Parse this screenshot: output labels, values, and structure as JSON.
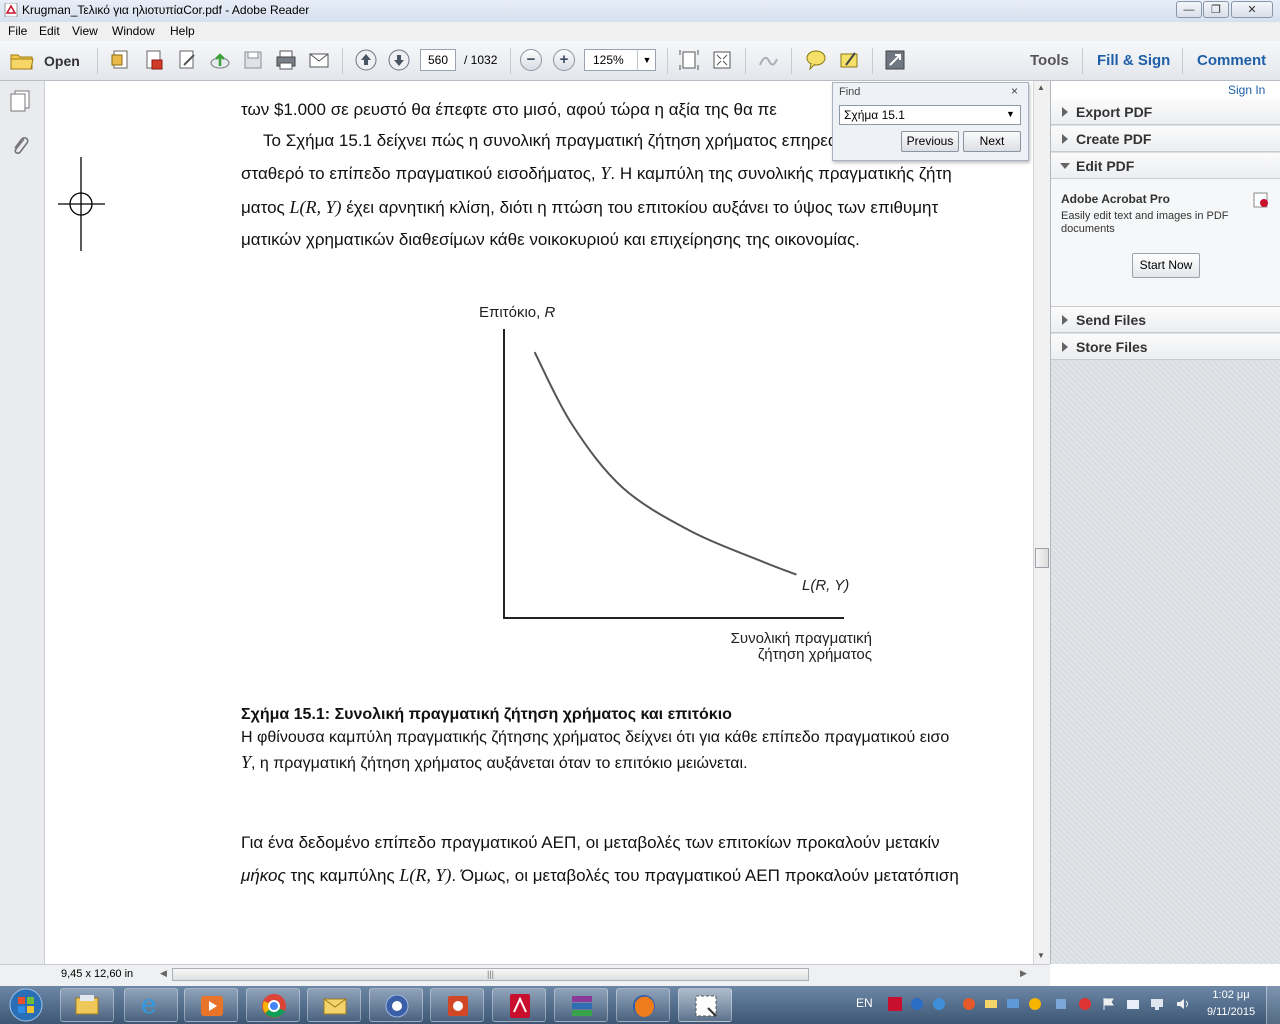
{
  "window": {
    "title": "Krugman_Τελικό για ηλιοτυπίαCor.pdf - Adobe Reader",
    "min_label": "—",
    "max_label": "❐",
    "close_label": "✕"
  },
  "menu": [
    "File",
    "Edit",
    "View",
    "Window",
    "Help"
  ],
  "toolbar": {
    "open_label": "Open",
    "page_current": "560",
    "page_total": "/ 1032",
    "zoom": "125%",
    "tabs": [
      "Tools",
      "Fill & Sign",
      "Comment"
    ],
    "signin": "Sign In"
  },
  "find": {
    "title": "Find",
    "query": "Σχήμα 15.1",
    "previous": "Previous",
    "next": "Next"
  },
  "document": {
    "line1": "των $1.000 σε ρευστό θα έπεφτε στο μισό, αφού τώρα η αξία της θα πε",
    "para2_l1": "Το Σχήμα 15.1 δείχνει πώς η συνολική πραγματική ζήτηση χρήματος επηρεάζ",
    "para2_l2a": "σταθερό το επίπεδο πραγματικού εισοδήματος, ",
    "para2_l2_var": "Y",
    "para2_l2b": ". Η καμπύλη της συνολικής πραγματικής ζήτη",
    "para2_l3a": "ματος ",
    "para2_l3_var": "L(R, Y)",
    "para2_l3b": " έχει αρνητική κλίση, διότι η πτώση του επιτοκίου αυξάνει το ύψος των επιθυμητ",
    "para2_l4": "ματικών χρηματικών διαθεσίμων κάθε νοικοκυριού και επιχείρησης της οικονομίας.",
    "caption_title": "Σχήμα 15.1: Συνολική πραγματική ζήτηση χρήματος και επιτόκιο",
    "caption_l1": "Η φθίνουσα καμπύλη πραγματικής ζήτησης χρήματος δείχνει ότι για κάθε επίπεδο πραγματικού εισο",
    "caption_l2_var": "Y",
    "caption_l2": ", η πραγματική ζήτηση χρήματος αυξάνεται όταν το επιτόκιο μειώνεται.",
    "para3_l1": "Για ένα δεδομένο επίπεδο πραγματικού ΑΕΠ, οι μεταβολές των επιτοκίων προκαλούν μετακίν",
    "para3_l2_em": "μήκος",
    "para3_l2a": " της καμπύλης ",
    "para3_l2_var": "L(R, Y)",
    "para3_l2b": ". Όμως, οι μεταβολές του πραγματικού ΑΕΠ προκαλούν μετατόπιση"
  },
  "chart_data": {
    "type": "line",
    "ylabel_text": "Επιτόκιο, ",
    "ylabel_var": "R",
    "xlabel_l1": "Συνολική πραγματική",
    "xlabel_l2": "ζήτηση χρήματος",
    "series": [
      {
        "name": "L(R, Y)",
        "points_note": "",
        "x": [
          0.09,
          0.2,
          0.35,
          0.55,
          0.75,
          0.86
        ],
        "y": [
          0.92,
          0.67,
          0.45,
          0.3,
          0.2,
          0.15
        ]
      }
    ],
    "xlim": [
      0,
      1
    ],
    "ylim": [
      0,
      1
    ]
  },
  "rightpanel": {
    "sections_top": [
      "Export PDF",
      "Create PDF",
      "Edit PDF"
    ],
    "promo_title": "Adobe Acrobat Pro",
    "promo_desc_l1": "Easily edit text and images in PDF",
    "promo_desc_l2": "documents",
    "start_now": "Start Now",
    "sections_bottom": [
      "Send Files",
      "Store Files"
    ]
  },
  "status": {
    "page_size": "9,45 x 12,60 in"
  },
  "taskbar": {
    "lang": "EN",
    "time": "1:02 μμ",
    "date": "9/11/2015"
  },
  "colors": {
    "accent_blue": "#1f5fa8",
    "pdf_red": "#c8102e"
  }
}
